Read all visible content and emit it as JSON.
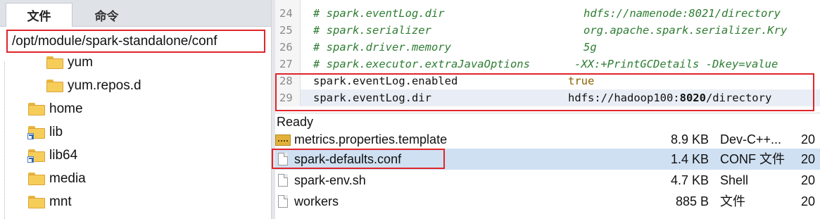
{
  "tabs": {
    "files": "文件",
    "commands": "命令"
  },
  "path": "/opt/module/spark-standalone/conf",
  "tree": [
    {
      "label": "yum",
      "type": "folder"
    },
    {
      "label": "yum.repos.d",
      "type": "folder"
    },
    {
      "label": "home",
      "type": "folder"
    },
    {
      "label": "lib",
      "type": "link-folder"
    },
    {
      "label": "lib64",
      "type": "link-folder"
    },
    {
      "label": "media",
      "type": "folder"
    },
    {
      "label": "mnt",
      "type": "folder"
    }
  ],
  "editor": {
    "lines": [
      {
        "num": "24",
        "key": "# spark.eventLog.dir",
        "value": "hdfs://namenode:8021/directory"
      },
      {
        "num": "25",
        "key": "# spark.serializer",
        "value": "org.apache.spark.serializer.Kry"
      },
      {
        "num": "26",
        "key": "# spark.driver.memory",
        "value": "5g"
      },
      {
        "num": "27",
        "key": "# spark.executor.extraJavaOptions",
        "value": "-XX:+PrintGCDetails -Dkey=value"
      },
      {
        "num": "28",
        "key": "spark.eventLog.enabled",
        "value": "true"
      },
      {
        "num": "29",
        "key": "spark.eventLog.dir",
        "value_a": "hdfs://hadoop100:",
        "value_b": "8020",
        "value_c": "/directory"
      }
    ]
  },
  "status": "Ready",
  "files": [
    {
      "name": "metrics.properties.template",
      "size": "8.9 KB",
      "type": "Dev-C++...",
      "date": "20",
      "icon": "dev-file-icon"
    },
    {
      "name": "spark-defaults.conf",
      "size": "1.4 KB",
      "type": "CONF 文件",
      "date": "20",
      "icon": "file-icon"
    },
    {
      "name": "spark-env.sh",
      "size": "4.7 KB",
      "type": "Shell",
      "date": "20",
      "icon": "file-icon"
    },
    {
      "name": "workers",
      "size": "885 B",
      "type": "文件",
      "date": "20",
      "icon": "file-icon"
    }
  ],
  "colors": {
    "highlight": "#e0252b",
    "comment": "#2e7d32",
    "value": "#8a6200",
    "selection": "#cfe0f2"
  }
}
